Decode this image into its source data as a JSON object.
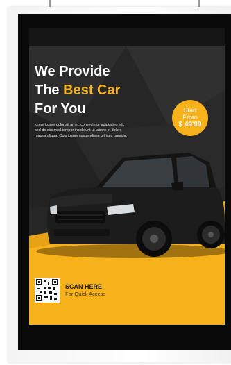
{
  "headline": {
    "line1": "We Provide",
    "line2_prefix": "The ",
    "line2_accent": "Best Car",
    "line3": "For You"
  },
  "body_text": "lorem ipsum dolor sit amet, consectetur adipiscing elit, sed do eiusmod tempor incididunt ut labore et dolore magna aliqua. Quis ipsum suspendisse ultrices gravida.",
  "price_badge": {
    "line1": "Start",
    "line2": "From",
    "price": "$ 49'99"
  },
  "scan": {
    "title": "SCAN HERE",
    "subtitle": "For Quick Access"
  },
  "colors": {
    "accent": "#f7b11a",
    "screen_bg": "#262626",
    "bezel": "#0a0a0a",
    "car_body": "#1c1c1c"
  }
}
